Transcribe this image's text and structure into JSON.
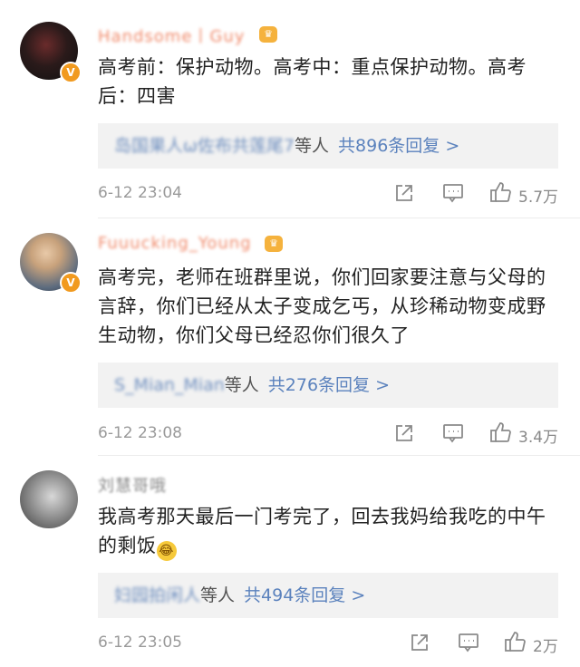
{
  "comments": [
    {
      "username": "Handsome丨Guy",
      "text": "高考前：保护动物。高考中：重点保护动物。高考后：四害",
      "reply_users": "岛国果人ω佐布共莲尾7",
      "reply_suffix": "等人",
      "reply_link": "共896条回复 >",
      "time": "6-12 23:04",
      "likes": "5.7万",
      "icons": [
        "share-icon",
        "comment-icon",
        "like-icon"
      ]
    },
    {
      "username": "Fuuucking_Young",
      "text": "高考完，老师在班群里说，你们回家要注意与父母的言辞，你们已经从太子变成乞丐，从珍稀动物变成野生动物，你们父母已经忍你们很久了",
      "reply_users": "S_Mian_Mian",
      "reply_suffix": "等人",
      "reply_link": "共276条回复 >",
      "time": "6-12 23:08",
      "likes": "3.4万",
      "icons": [
        "share-icon",
        "comment-icon",
        "like-icon"
      ]
    },
    {
      "username": "刘慧哥哦",
      "text": "我高考那天最后一门考完了，回去我妈给我吃的中午的剩饭",
      "reply_users": "妇园拍闲人",
      "reply_suffix": "等人",
      "reply_link": "共494条回复 >",
      "time": "6-12 23:05",
      "likes": "2万",
      "icons": [
        "share-icon",
        "comment-icon",
        "like-icon"
      ]
    }
  ],
  "badges": {
    "verified": "V",
    "crown": "♛"
  },
  "emoji": "😂",
  "colors": {
    "username_vip": "#f08a6b",
    "link": "#5b82bd",
    "badge": "#f19a1f",
    "reply_bg": "#f2f2f2"
  }
}
